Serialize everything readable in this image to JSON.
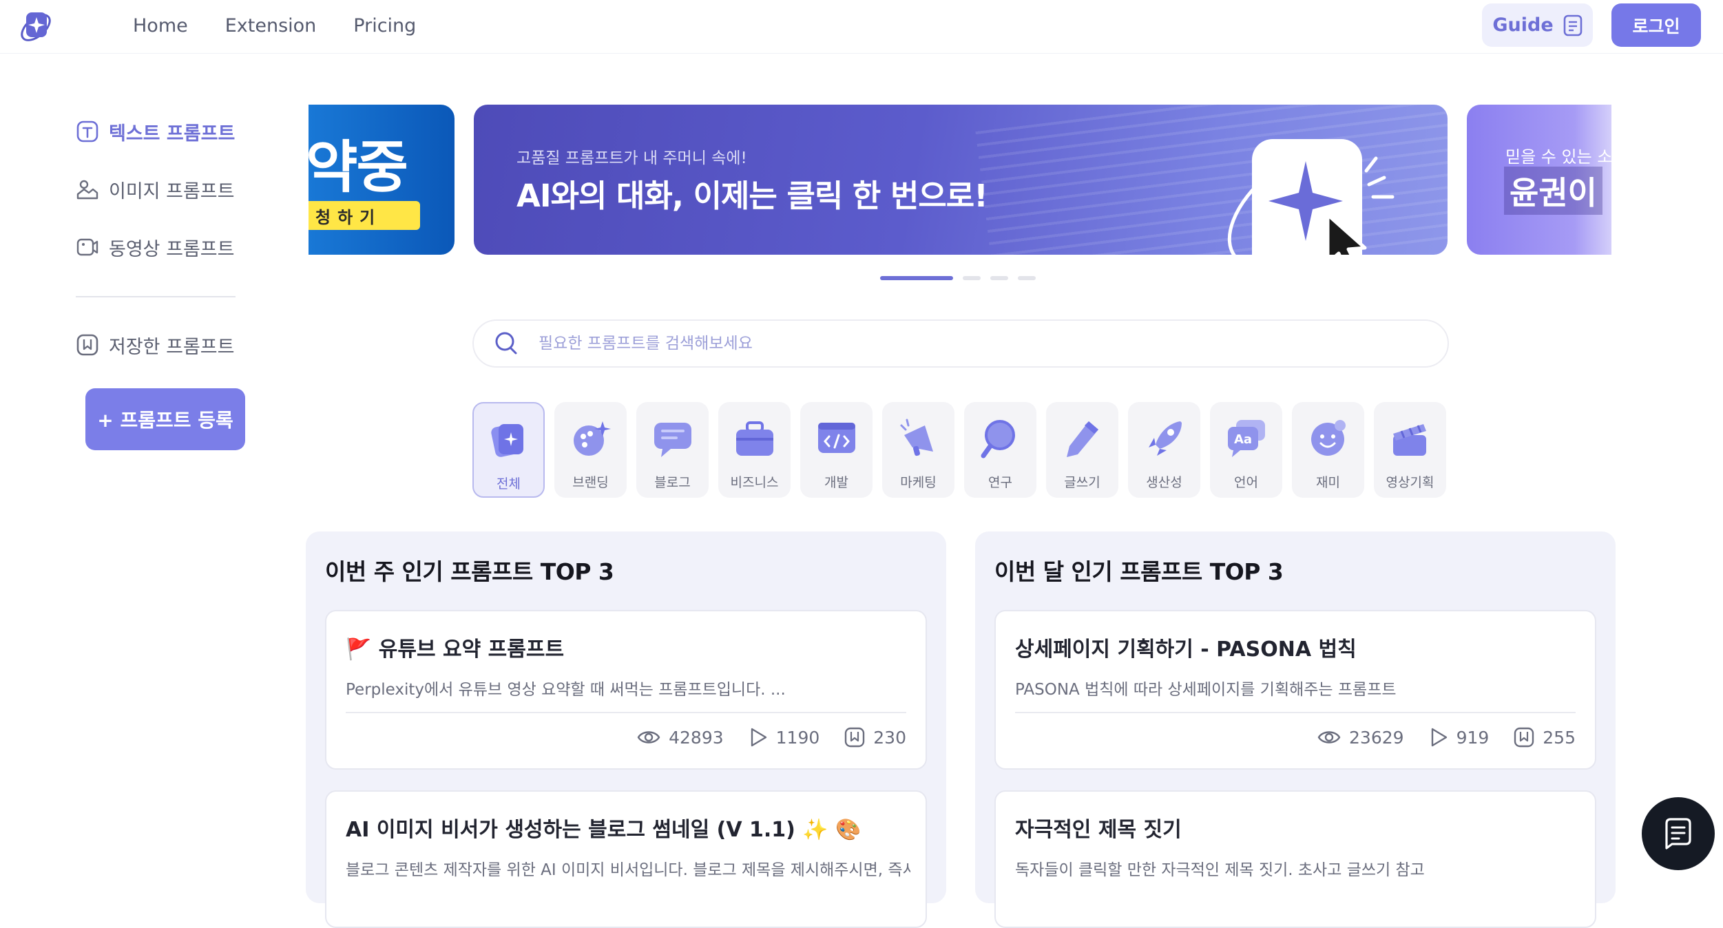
{
  "header": {
    "nav": [
      "Home",
      "Extension",
      "Pricing"
    ],
    "guide_label": "Guide",
    "login_label": "로그인"
  },
  "sidebar": {
    "items": [
      {
        "label": "텍스트 프롬프트",
        "icon": "text-box-icon",
        "active": true
      },
      {
        "label": "이미지 프롬프트",
        "icon": "image-icon",
        "active": false
      },
      {
        "label": "동영상 프롬프트",
        "icon": "video-icon",
        "active": false
      }
    ],
    "saved_label": "저장한 프롬프트",
    "register_label": "+ 프롬프트 등록"
  },
  "banners": {
    "left": {
      "big": "약중",
      "pill": "청하기"
    },
    "main": {
      "subtitle": "고품질 프롬프트가 내 주머니 속에!",
      "title": "AI와의 대화, 이제는 클릭 한 번으로!"
    },
    "right": {
      "subtitle": "믿을 수 있는 소",
      "title": "윤권이"
    },
    "active_index": 0,
    "count": 4
  },
  "search": {
    "placeholder": "필요한 프롬프트를 검색해보세요"
  },
  "categories": [
    "전체",
    "브랜딩",
    "블로그",
    "비즈니스",
    "개발",
    "마케팅",
    "연구",
    "글쓰기",
    "생산성",
    "언어",
    "재미",
    "영상기획"
  ],
  "weekly": {
    "title": "이번 주 인기 프롬프트 TOP 3",
    "cards": [
      {
        "title": "🚩 유튜브 요약 프롬프트",
        "desc": "Perplexity에서 유튜브 영상 요약할 때 써먹는 프롬프트입니다. ...",
        "views": "42893",
        "runs": "1190",
        "saves": "230"
      },
      {
        "title": " AI 이미지 비서가 생성하는 블로그 썸네일 (V 1.1) ✨ 🎨",
        "desc": "블로그 콘텐츠 제작자를 위한 AI 이미지 비서입니다. 블로그 제목을 제시해주시면, 즉시..."
      }
    ]
  },
  "monthly": {
    "title": "이번 달 인기 프롬프트 TOP 3",
    "cards": [
      {
        "title": "상세페이지 기획하기 - PASONA 법칙",
        "desc": "PASONA 법칙에 따라 상세페이지를 기획해주는 프롬프트",
        "views": "23629",
        "runs": "919",
        "saves": "255"
      },
      {
        "title": "자극적인 제목 짓기",
        "desc": "독자들이 클릭할 만한 자극적인 제목 짓기. 초사고 글쓰기 참고"
      }
    ]
  },
  "colors": {
    "accent": "#7678e8",
    "accent_text": "#6d6fd6",
    "fab": "#151a24"
  }
}
